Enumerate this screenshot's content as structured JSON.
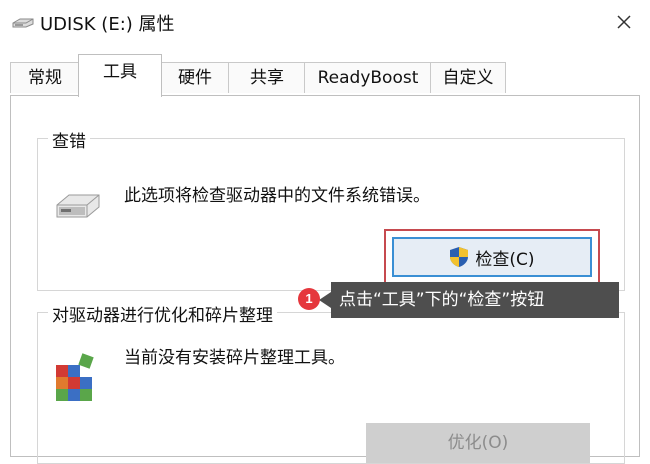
{
  "window": {
    "title": "UDISK (E:) 属性",
    "close_icon": "close-icon",
    "title_icon": "usb-drive-icon"
  },
  "tabs": [
    {
      "label": "常规",
      "active": false
    },
    {
      "label": "工具",
      "active": true
    },
    {
      "label": "硬件",
      "active": false
    },
    {
      "label": "共享",
      "active": false
    },
    {
      "label": "ReadyBoost",
      "active": false
    },
    {
      "label": "自定义",
      "active": false
    }
  ],
  "error_check": {
    "title": "查错",
    "description": "此选项将检查驱动器中的文件系统错误。",
    "button_label": "检查(C)",
    "button_icon": "uac-shield-icon",
    "icon": "drive-icon"
  },
  "optimize": {
    "title": "对驱动器进行优化和碎片整理",
    "description": "当前没有安装碎片整理工具。",
    "button_label": "优化(O)",
    "button_enabled": false,
    "icon": "defrag-icon"
  },
  "annotation": {
    "step_number": "1",
    "text": "点击“工具”下的“检查”按钮",
    "highlight_color": "#c64a4f",
    "callout_color": "#4e4e4e",
    "badge_color": "#e5373d"
  }
}
